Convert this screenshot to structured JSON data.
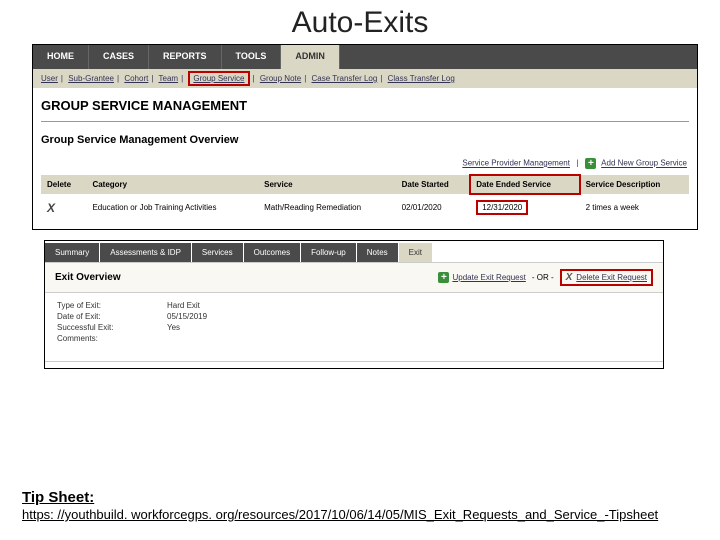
{
  "title": "Auto-Exits",
  "mainnav": {
    "items": [
      "HOME",
      "CASES",
      "REPORTS",
      "TOOLS",
      "ADMIN"
    ],
    "activeIndex": 4
  },
  "subnav": {
    "items": [
      "User",
      "Sub-Grantee",
      "Cohort",
      "Team",
      "Group Service",
      "Group Note",
      "Case Transfer Log",
      "Class Transfer Log"
    ],
    "highlightIndex": 4
  },
  "gsm": {
    "heading": "GROUP SERVICE MANAGEMENT",
    "subheading": "Group Service Management Overview",
    "links": {
      "spm": "Service Provider Management",
      "add": "Add New Group Service"
    },
    "columns": [
      "Delete",
      "Category",
      "Service",
      "Date Started",
      "Date Ended Service",
      "Service Description"
    ],
    "row": {
      "category": "Education or Job Training Activities",
      "service": "Math/Reading Remediation",
      "date_started": "02/01/2020",
      "date_ended": "12/31/2020",
      "description": "2 times a week"
    }
  },
  "tabs2": {
    "items": [
      "Summary",
      "Assessments & IDP",
      "Services",
      "Outcomes",
      "Follow-up",
      "Notes",
      "Exit"
    ],
    "activeIndex": 6
  },
  "exit": {
    "title": "Exit Overview",
    "update": "Update Exit Request",
    "or": "- OR -",
    "del": "Delete Exit Request",
    "fields": {
      "type_label": "Type of Exit:",
      "type_val": "Hard Exit",
      "date_label": "Date of Exit:",
      "date_val": "05/15/2019",
      "succ_label": "Successful Exit:",
      "succ_val": "Yes",
      "comm_label": "Comments:",
      "comm_val": ""
    }
  },
  "footer": {
    "tip": "Tip Sheet:",
    "link": "https: //youthbuild. workforcegps. org/resources/2017/10/06/14/05/MIS_Exit_Requests_and_Service_-Tipsheet"
  }
}
